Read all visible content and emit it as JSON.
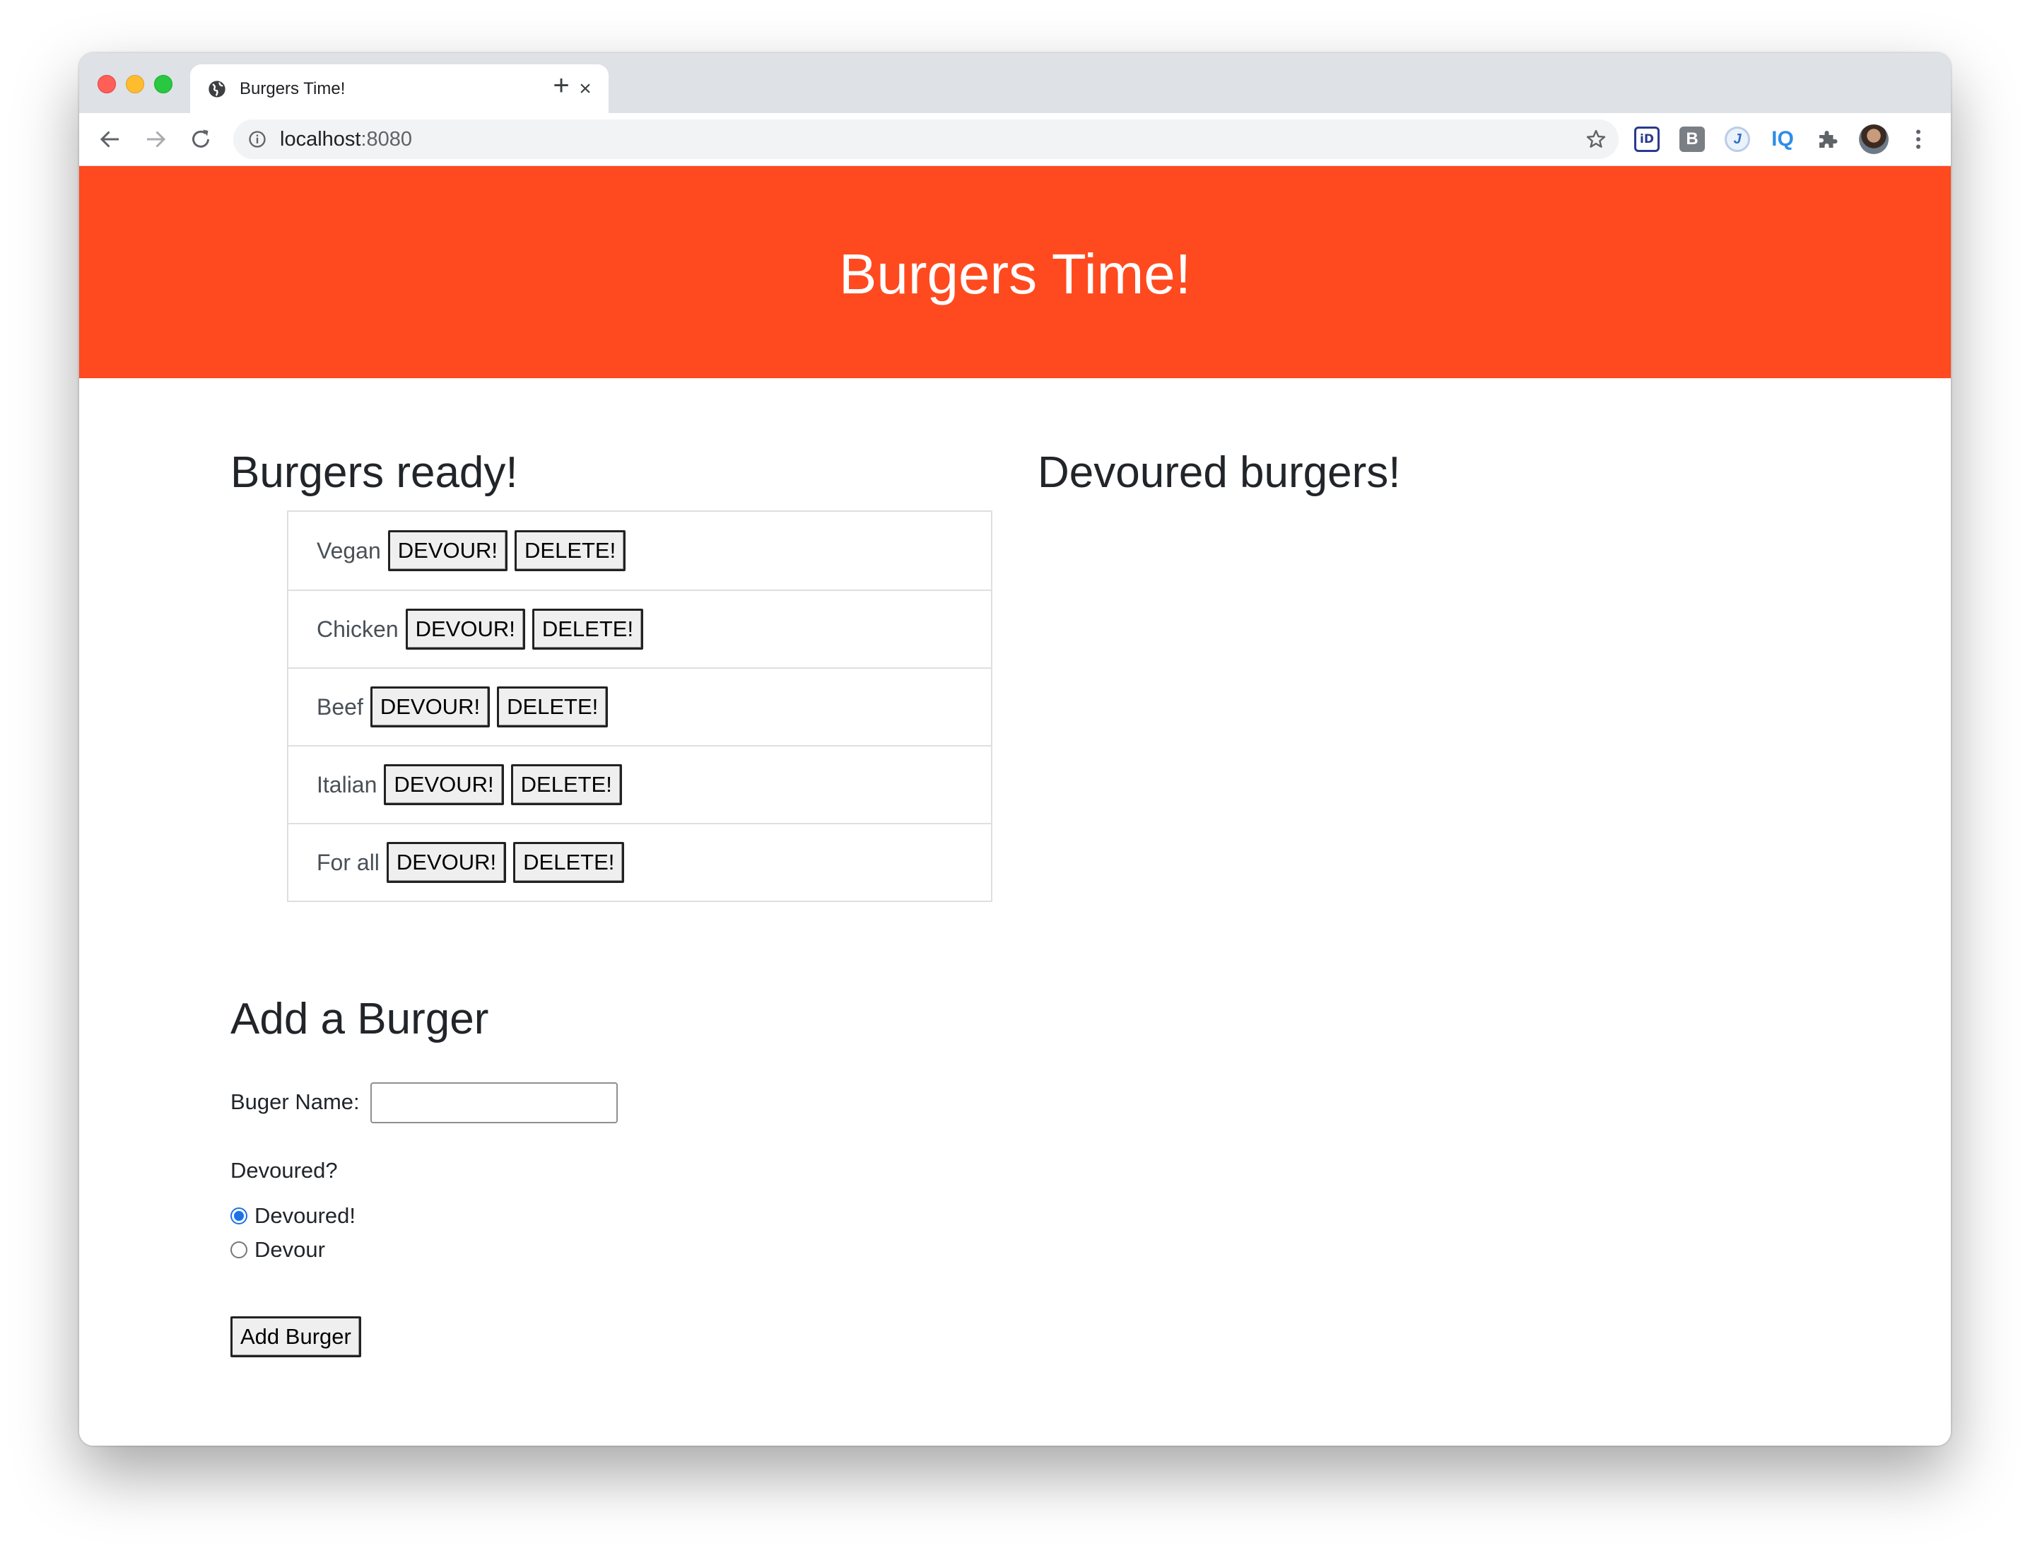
{
  "browser": {
    "tab_title": "Burgers Time!",
    "tab_close": "×",
    "new_tab": "+",
    "url_host": "localhost",
    "url_port": ":8080"
  },
  "page": {
    "banner_title": "Burgers Time!",
    "ready_heading": "Burgers ready!",
    "devoured_heading": "Devoured burgers!",
    "burgers": [
      {
        "name": "Vegan",
        "devour_label": "DEVOUR!",
        "delete_label": "DELETE!"
      },
      {
        "name": "Chicken",
        "devour_label": "DEVOUR!",
        "delete_label": "DELETE!"
      },
      {
        "name": "Beef",
        "devour_label": "DEVOUR!",
        "delete_label": "DELETE!"
      },
      {
        "name": "Italian",
        "devour_label": "DEVOUR!",
        "delete_label": "DELETE!"
      },
      {
        "name": "For all",
        "devour_label": "DEVOUR!",
        "delete_label": "DELETE!"
      }
    ],
    "form": {
      "heading": "Add a Burger",
      "name_label": "Buger Name:",
      "name_value": "",
      "devoured_question": "Devoured?",
      "options": [
        {
          "label": "Devoured!",
          "checked": true
        },
        {
          "label": "Devour",
          "checked": false
        }
      ],
      "submit_label": "Add Burger"
    }
  },
  "colors": {
    "banner": "#ff4a1f",
    "radio_accent": "#1a73e8"
  },
  "icons": [
    "globe-icon",
    "close-icon",
    "plus-icon",
    "back-arrow-icon",
    "forward-arrow-icon",
    "reload-icon",
    "info-icon",
    "star-icon",
    "extension-id-icon",
    "extension-b-icon",
    "extension-j-icon",
    "extension-iq-icon",
    "puzzle-icon",
    "profile-avatar",
    "more-vert-icon"
  ],
  "extensions": {
    "id_label": "iD",
    "b_label": "B",
    "j_label": "J",
    "iq_label": "IQ"
  }
}
